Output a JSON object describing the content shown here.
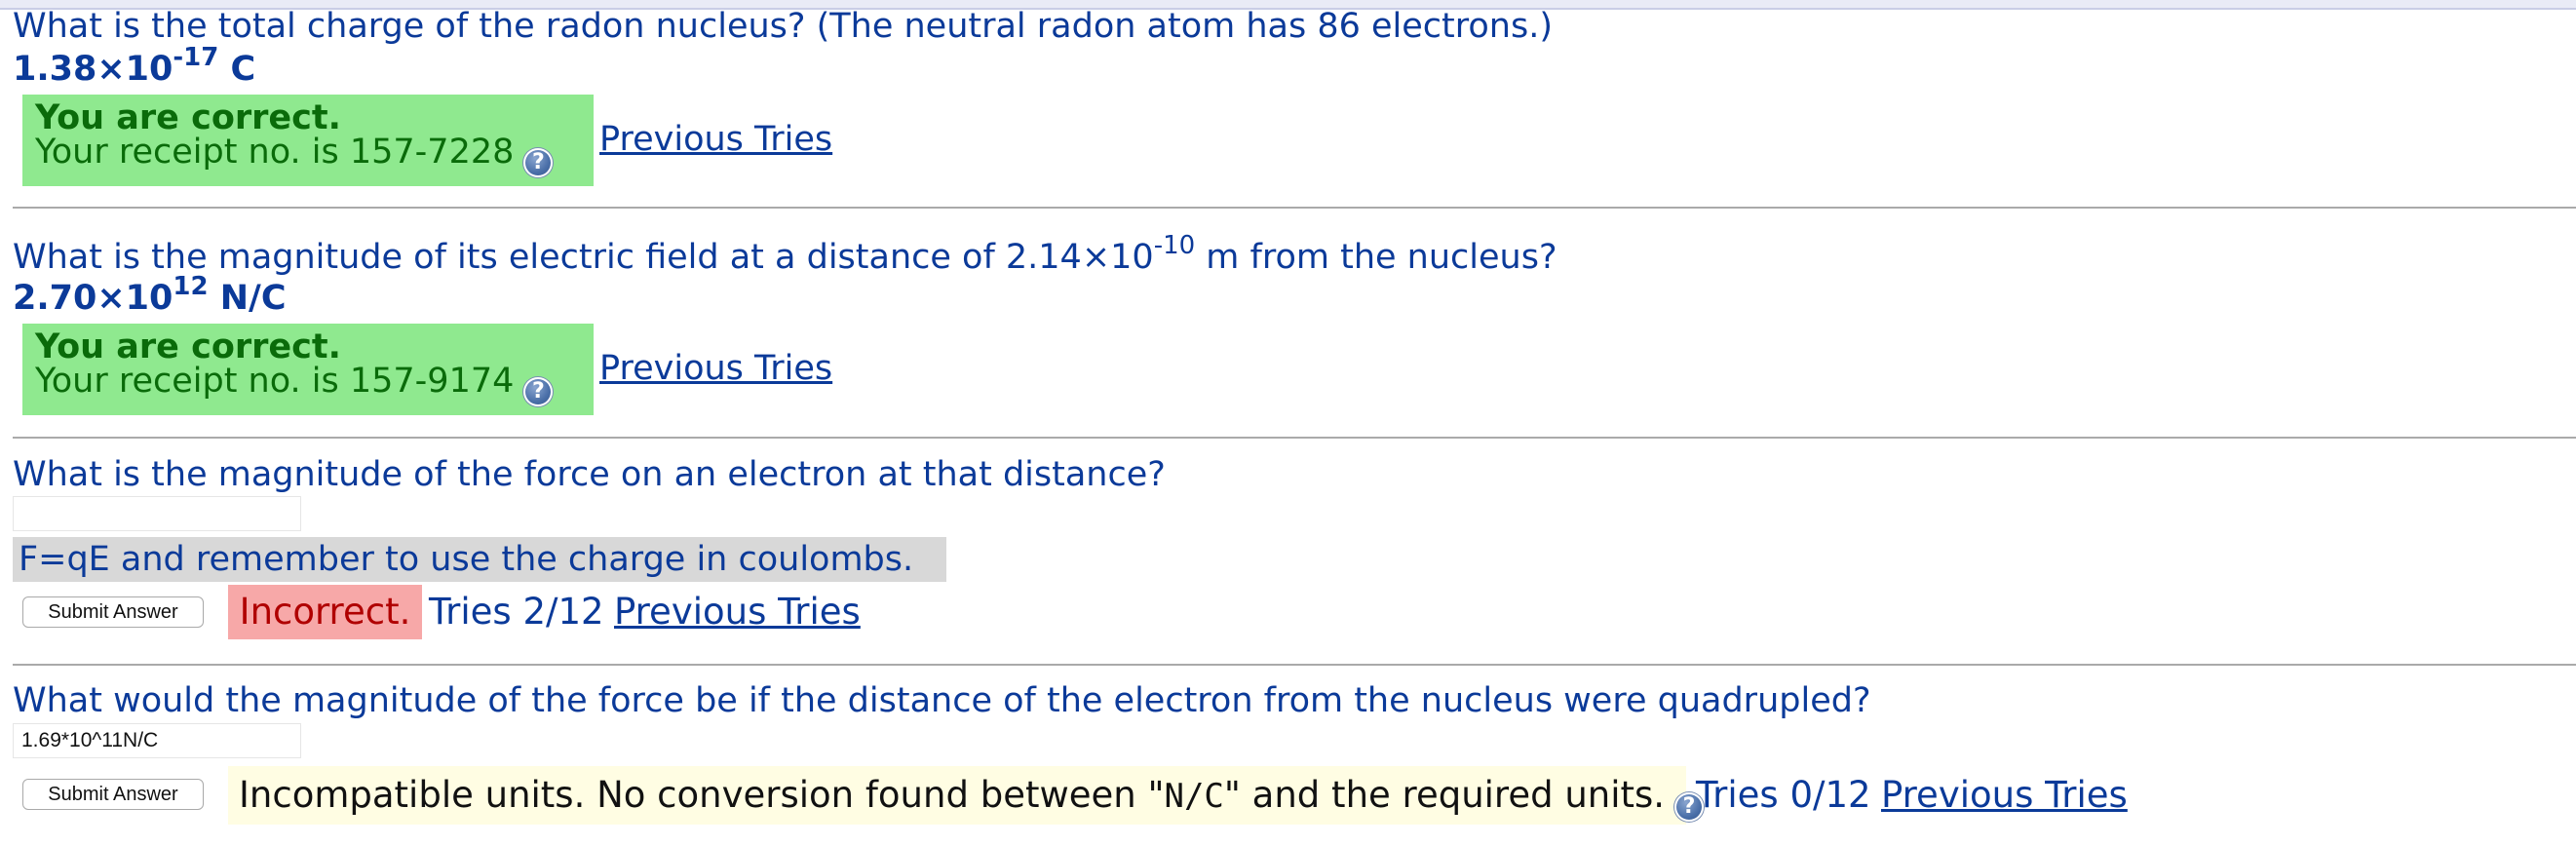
{
  "questions": [
    {
      "text": "What is the total charge of the radon nucleus? (The neutral radon atom has 86 electrons.)",
      "answer_mantissa": "1.38×10",
      "answer_exponent": "-17",
      "answer_unit": " C",
      "status_title": "You are correct.",
      "receipt": "Your receipt no. is 157-7228",
      "previous_tries_label": "Previous Tries"
    },
    {
      "text_before": "What is the magnitude of its electric field at a distance of 2.14×10",
      "text_exponent": "-10",
      "text_after": " m from the nucleus?",
      "answer_mantissa": "2.70×10",
      "answer_exponent": "12",
      "answer_unit": " N/C",
      "status_title": "You are correct.",
      "receipt": "Your receipt no. is 157-9174",
      "previous_tries_label": "Previous Tries"
    },
    {
      "text": "What is the magnitude of the force on an electron at that distance?",
      "input_value": "",
      "hint": "F=qE and remember to use the charge in coulombs.",
      "submit_label": "Submit Answer",
      "status": "Incorrect.",
      "tries": "Tries 2/12",
      "previous_tries_label": "Previous Tries"
    },
    {
      "text": "What would the magnitude of the force be if the distance of the electron from the nucleus were quadrupled?",
      "input_value": "1.69*10^11N/C",
      "submit_label": "Submit Answer",
      "message_before": "Incompatible units. No conversion found between \"",
      "message_unit": "N/C",
      "message_after": "\" and the required units.",
      "tries": "Tries 0/12",
      "previous_tries_label": "Previous Tries"
    }
  ],
  "icons": {
    "help": "help-icon",
    "help_glyph": "?"
  },
  "colors": {
    "text": "#0b3a99",
    "correct_bg": "#8fe98f",
    "correct_text": "#0a6b0a",
    "incorrect_bg": "#f7a8a8",
    "hint_bg": "#d8d8d8",
    "units_msg_bg": "#fffde3"
  }
}
